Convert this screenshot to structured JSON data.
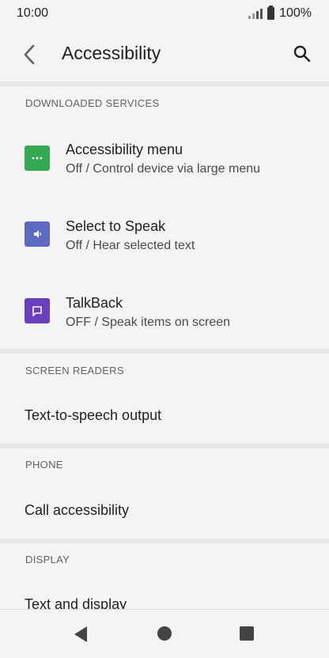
{
  "status_bar": {
    "time": "10:00",
    "battery": "100%"
  },
  "app_bar": {
    "title": "Accessibility",
    "back_icon": "arrow-back-icon",
    "search_icon": "search-icon"
  },
  "sections": {
    "downloaded": {
      "header": "DOWNLOADED SERVICES",
      "items": [
        {
          "title": "Accessibility menu",
          "subtitle": "Off / Control device via large menu",
          "icon": "accessibility-menu-icon",
          "color": "#34a853"
        },
        {
          "title": "Select to Speak",
          "subtitle": "Off / Hear selected text",
          "icon": "select-to-speak-icon",
          "color": "#5c6bc0"
        },
        {
          "title": "TalkBack",
          "subtitle": "OFF / Speak items on screen",
          "icon": "talkback-icon",
          "color": "#6a3fbf"
        }
      ]
    },
    "screen_readers": {
      "header": "SCREEN READERS",
      "item": "Text-to-speech output"
    },
    "phone": {
      "header": "PHONE",
      "item": "Call accessibility"
    },
    "display": {
      "header": "DISPLAY",
      "item": "Text and display"
    }
  },
  "nav_bar": {
    "back": "nav-back-icon",
    "home": "nav-home-icon",
    "recents": "nav-recents-icon"
  }
}
